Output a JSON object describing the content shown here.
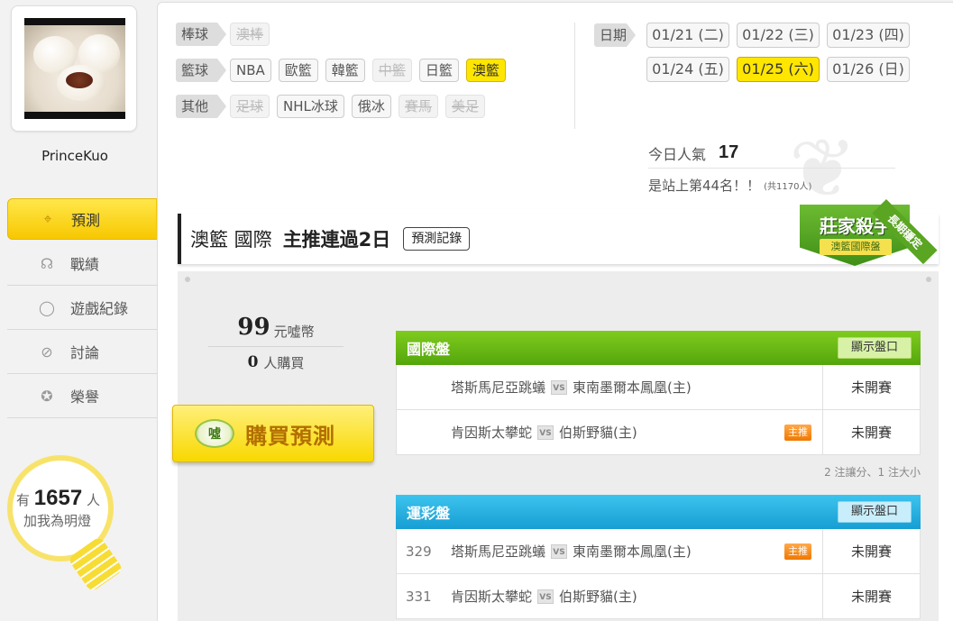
{
  "user": {
    "name": "PrinceKuo"
  },
  "nav": [
    {
      "label": "預測",
      "icon": "crosshair-icon",
      "glyph": "⌖",
      "active": true
    },
    {
      "label": "戰績",
      "icon": "speech-bubble-icon",
      "glyph": "☊",
      "active": false
    },
    {
      "label": "遊戲紀錄",
      "icon": "circle-icon",
      "glyph": "◯",
      "active": false
    },
    {
      "label": "討論",
      "icon": "magnifier-icon",
      "glyph": "⊘",
      "active": false
    },
    {
      "label": "榮譽",
      "icon": "medal-icon",
      "glyph": "✪",
      "active": false
    }
  ],
  "followers": {
    "prefix": "有",
    "count": "1657",
    "suffix": "人",
    "line2": "加我為明燈"
  },
  "categories": [
    {
      "label": "棒球",
      "chips": [
        {
          "text": "澳棒",
          "state": "disabled"
        }
      ]
    },
    {
      "label": "籃球",
      "chips": [
        {
          "text": "NBA",
          "state": "normal"
        },
        {
          "text": "歐籃",
          "state": "normal"
        },
        {
          "text": "韓籃",
          "state": "normal"
        },
        {
          "text": "中籃",
          "state": "disabled"
        },
        {
          "text": "日籃",
          "state": "normal"
        },
        {
          "text": "澳籃",
          "state": "active"
        }
      ]
    },
    {
      "label": "其他",
      "chips": [
        {
          "text": "足球",
          "state": "disabled"
        },
        {
          "text": "NHL冰球",
          "state": "normal"
        },
        {
          "text": "俄冰",
          "state": "normal"
        },
        {
          "text": "賽馬",
          "state": "disabled"
        },
        {
          "text": "美足",
          "state": "disabled"
        }
      ]
    }
  ],
  "dates": {
    "label": "日期",
    "row1": [
      {
        "text": "01/21 (二)",
        "active": false
      },
      {
        "text": "01/22 (三)",
        "active": false
      },
      {
        "text": "01/23 (四)",
        "active": false
      }
    ],
    "row2": [
      {
        "text": "01/24 (五)",
        "active": false
      },
      {
        "text": "01/25 (六)",
        "active": true
      },
      {
        "text": "01/26 (日)",
        "active": false
      }
    ]
  },
  "popularity": {
    "label": "今日人氣",
    "value": "17",
    "rank_text": "是站上第44名！！",
    "total": "(共1170人)"
  },
  "title": {
    "league": "澳籃 國際",
    "streak": "主推連過2日",
    "record_button": "預測記錄"
  },
  "badge": {
    "main": "莊家殺手",
    "sub": "澳籃國際盤",
    "ribbon": "長期穩定"
  },
  "price": {
    "amount": "99",
    "unit": "元噓幣",
    "buyers": "0",
    "buyers_unit": "人購買"
  },
  "buy_button": {
    "coin": "噓",
    "label": "購買預測"
  },
  "odds": {
    "intl": {
      "title": "國際盤",
      "show_button": "顯示盤口",
      "rows": [
        {
          "num": "",
          "home": "塔斯馬尼亞跳蟻",
          "away": "東南墨爾本鳳凰(主)",
          "featured": false,
          "status": "未開賽"
        },
        {
          "num": "",
          "home": "肯因斯太攀蛇",
          "away": "伯斯野貓(主)",
          "featured": true,
          "status": "未開賽"
        }
      ],
      "note": "2 注讓分、1 注大小"
    },
    "lottery": {
      "title": "運彩盤",
      "show_button": "顯示盤口",
      "rows": [
        {
          "num": "329",
          "home": "塔斯馬尼亞跳蟻",
          "away": "東南墨爾本鳳凰(主)",
          "featured": true,
          "status": "未開賽"
        },
        {
          "num": "331",
          "home": "肯因斯太攀蛇",
          "away": "伯斯野貓(主)",
          "featured": false,
          "status": "未開賽"
        }
      ]
    },
    "vs_label": "VS",
    "featured_label": "主推"
  }
}
